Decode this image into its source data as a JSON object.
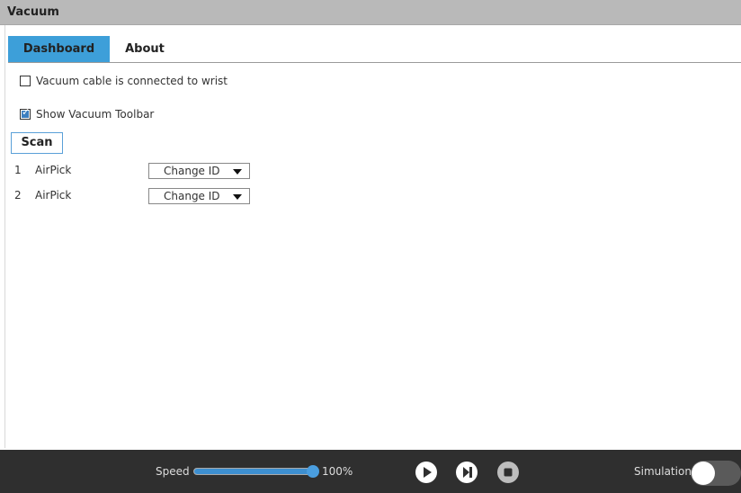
{
  "window": {
    "title": "Vacuum"
  },
  "tabs": [
    {
      "label": "Dashboard",
      "active": true
    },
    {
      "label": "About",
      "active": false
    }
  ],
  "options": {
    "cable_connected": {
      "label": "Vacuum cable is connected to wrist",
      "checked": false
    },
    "show_toolbar": {
      "label": "Show Vacuum Toolbar",
      "checked": true
    }
  },
  "scan_label": "Scan",
  "devices": [
    {
      "index": "1",
      "name": "AirPick",
      "action": "Change ID"
    },
    {
      "index": "2",
      "name": "AirPick",
      "action": "Change ID"
    }
  ],
  "footer": {
    "speed_label": "Speed",
    "speed_value": "100%",
    "speed_fraction": 1.0,
    "simulation_label": "Simulation",
    "simulation_on": false,
    "controls": [
      "play-icon",
      "step-icon",
      "stop-icon"
    ]
  },
  "colors": {
    "accent": "#3d9fd9",
    "bar": "#2f2f2f",
    "title_bg": "#b9b9b9"
  }
}
